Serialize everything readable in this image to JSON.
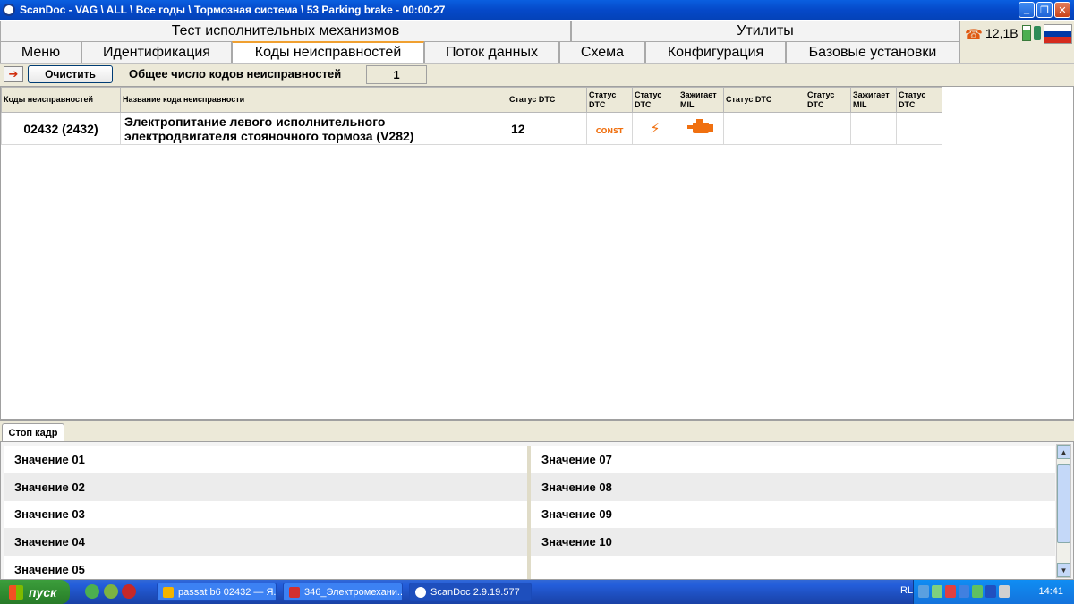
{
  "window": {
    "title": "ScanDoc - VAG \\ ALL \\ Все годы \\ Тормозная система \\ 53 Parking brake - 00:00:27"
  },
  "menu_row1": {
    "actuators_test": "Тест исполнительных механизмов",
    "utilities": "Утилиты"
  },
  "menu_row2": {
    "tabs": [
      {
        "label": "Меню"
      },
      {
        "label": "Идентификация"
      },
      {
        "label": "Коды неисправностей",
        "active": true
      },
      {
        "label": "Поток данных"
      },
      {
        "label": "Схема"
      },
      {
        "label": "Конфигурация"
      },
      {
        "label": "Базовые установки"
      }
    ]
  },
  "status": {
    "voltage": "12,1В",
    "phone_icon": "phone-icon",
    "battery_icon": "battery-icon",
    "flag_colors": [
      "#ffffff",
      "#0039a6",
      "#d52b1e"
    ]
  },
  "toolbar": {
    "clear_label": "Очистить",
    "total_label": "Общее число кодов неисправностей",
    "total_value": "1"
  },
  "table": {
    "headers": [
      "Коды неисправностей",
      "Название кода неисправности",
      "Статус DTC",
      "Статус DTC",
      "Статус DTC",
      "Зажигает MIL",
      "Статус DTC",
      "Статус DTC",
      "Зажигает MIL",
      "Статус DTC"
    ],
    "rows": [
      {
        "code": "02432 (2432)",
        "name_line1": "Электропитание левого исполнительного",
        "name_line2": "электродвигателя стояночного тормоза (V282)",
        "status": "12",
        "const_label": "CONST"
      }
    ]
  },
  "freeze_frame": {
    "tab_label": "Стоп кадр",
    "left": [
      "Значение 01",
      "Значение 02",
      "Значение 03",
      "Значение 04",
      "Значение 05"
    ],
    "right": [
      "Значение 07",
      "Значение 08",
      "Значение 09",
      "Значение 10",
      ""
    ]
  },
  "taskbar": {
    "start_label": "пуск",
    "tasks": [
      {
        "label": "passat b6 02432 — Я..."
      },
      {
        "label": "346_Электромехани..."
      },
      {
        "label": "ScanDoc 2.9.19.577",
        "active": true
      }
    ],
    "lang": "RL",
    "clock": "14:41"
  },
  "colors": {
    "accent_orange": "#f07010",
    "titlebar_blue": "#0549c9",
    "taskbar_blue": "#245edb"
  }
}
